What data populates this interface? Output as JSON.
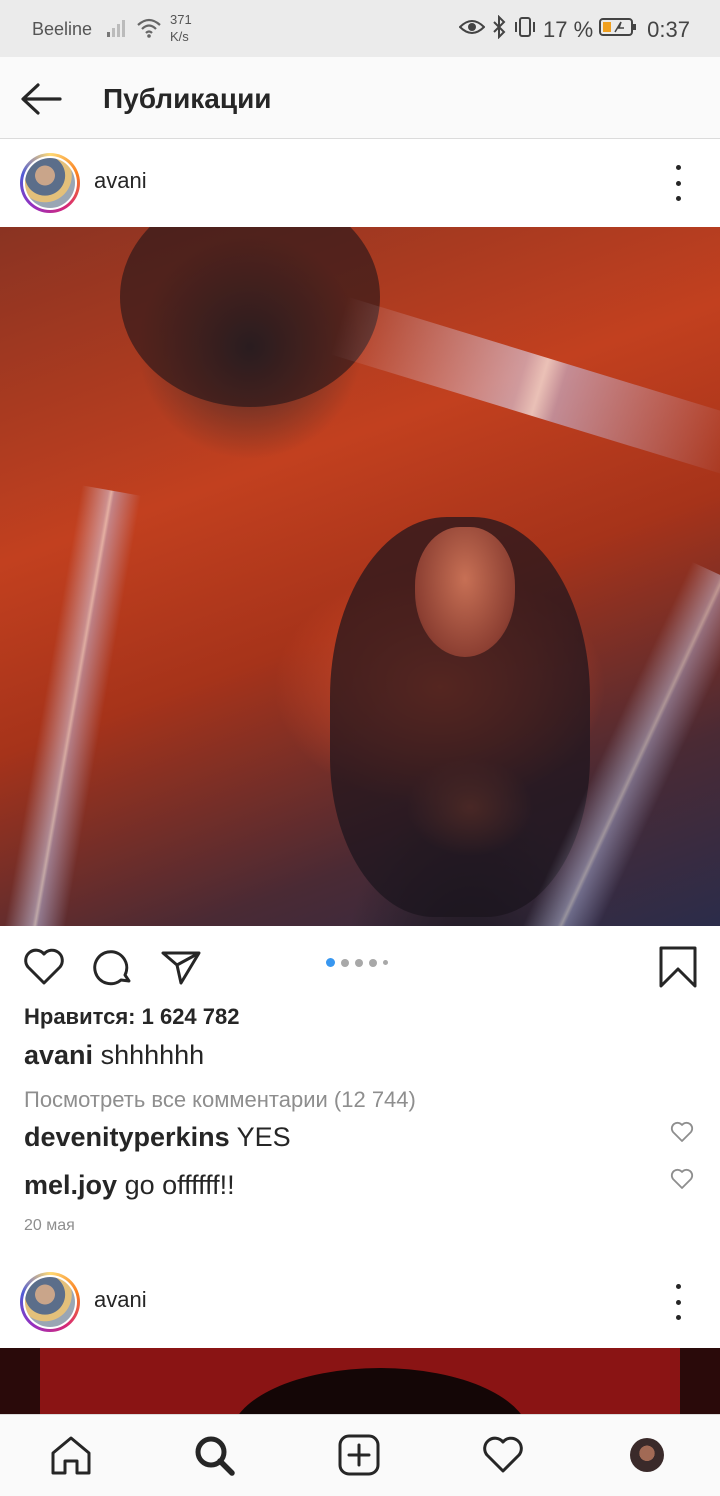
{
  "status_bar": {
    "carrier": "Beeline",
    "speed_value": "371",
    "speed_unit": "K/s",
    "battery_percent": "17 %",
    "time": "0:37",
    "icons": [
      "signal-icon",
      "wifi-icon",
      "eye-icon",
      "bluetooth-icon",
      "vibrate-icon",
      "battery-icon"
    ]
  },
  "header": {
    "back_icon": "arrow-left-icon",
    "title": "Публикации"
  },
  "post": {
    "username": "avani",
    "more_icon": "more-vertical-icon",
    "actions": [
      "heart-icon",
      "comment-icon",
      "send-icon",
      "bookmark-icon"
    ],
    "carousel": {
      "count": 5,
      "active_index": 0
    },
    "likes_text": "Нравится: 1 624 782",
    "caption": {
      "user": "avani",
      "text": "shhhhhh"
    },
    "view_comments": "Посмотреть все комментарии (12 744)",
    "comments": [
      {
        "user": "devenityperkins",
        "text": "YES"
      },
      {
        "user": "mel.joy",
        "text": "go offffff!!"
      }
    ],
    "date": "20 мая"
  },
  "next_post": {
    "username": "avani"
  },
  "bottom_nav": {
    "items": [
      "home-icon",
      "search-icon",
      "add-post-icon",
      "activity-heart-icon",
      "profile-avatar"
    ]
  },
  "colors": {
    "accent": "#3897f0",
    "text": "#262626",
    "muted": "#8e8e8e",
    "status_bar_bg": "#ebebeb"
  }
}
